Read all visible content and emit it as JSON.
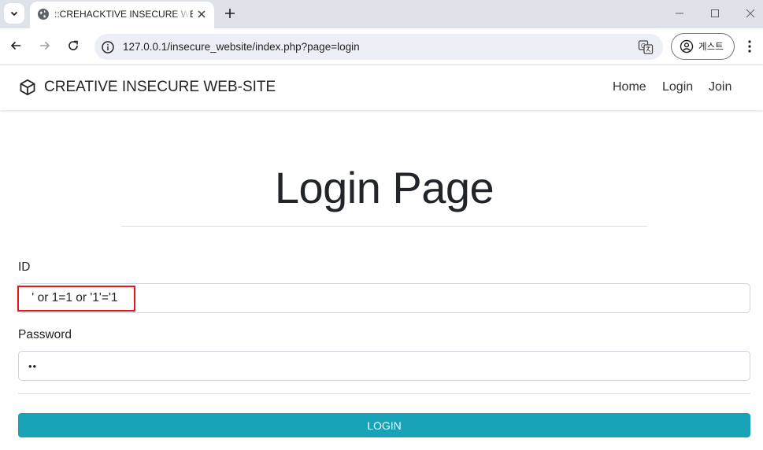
{
  "browser": {
    "tab": {
      "title": "::CREHACKTIVE INSECURE WEBSITE::"
    },
    "address": {
      "url": "127.0.0.1/insecure_website/index.php?page=login"
    },
    "profile_label": "게스트"
  },
  "navbar": {
    "brand": "CREATIVE INSECURE WEB-SITE",
    "links": [
      "Home",
      "Login",
      "Join"
    ]
  },
  "main": {
    "title": "Login Page",
    "id_label": "ID",
    "id_value": " ' or 1=1 or '1'='1",
    "password_label": "Password",
    "password_value": "••",
    "login_button": "LOGIN"
  },
  "colors": {
    "accent": "#17a2b8",
    "highlight": "#e8141d",
    "tabstrip": "#dee3ea"
  }
}
